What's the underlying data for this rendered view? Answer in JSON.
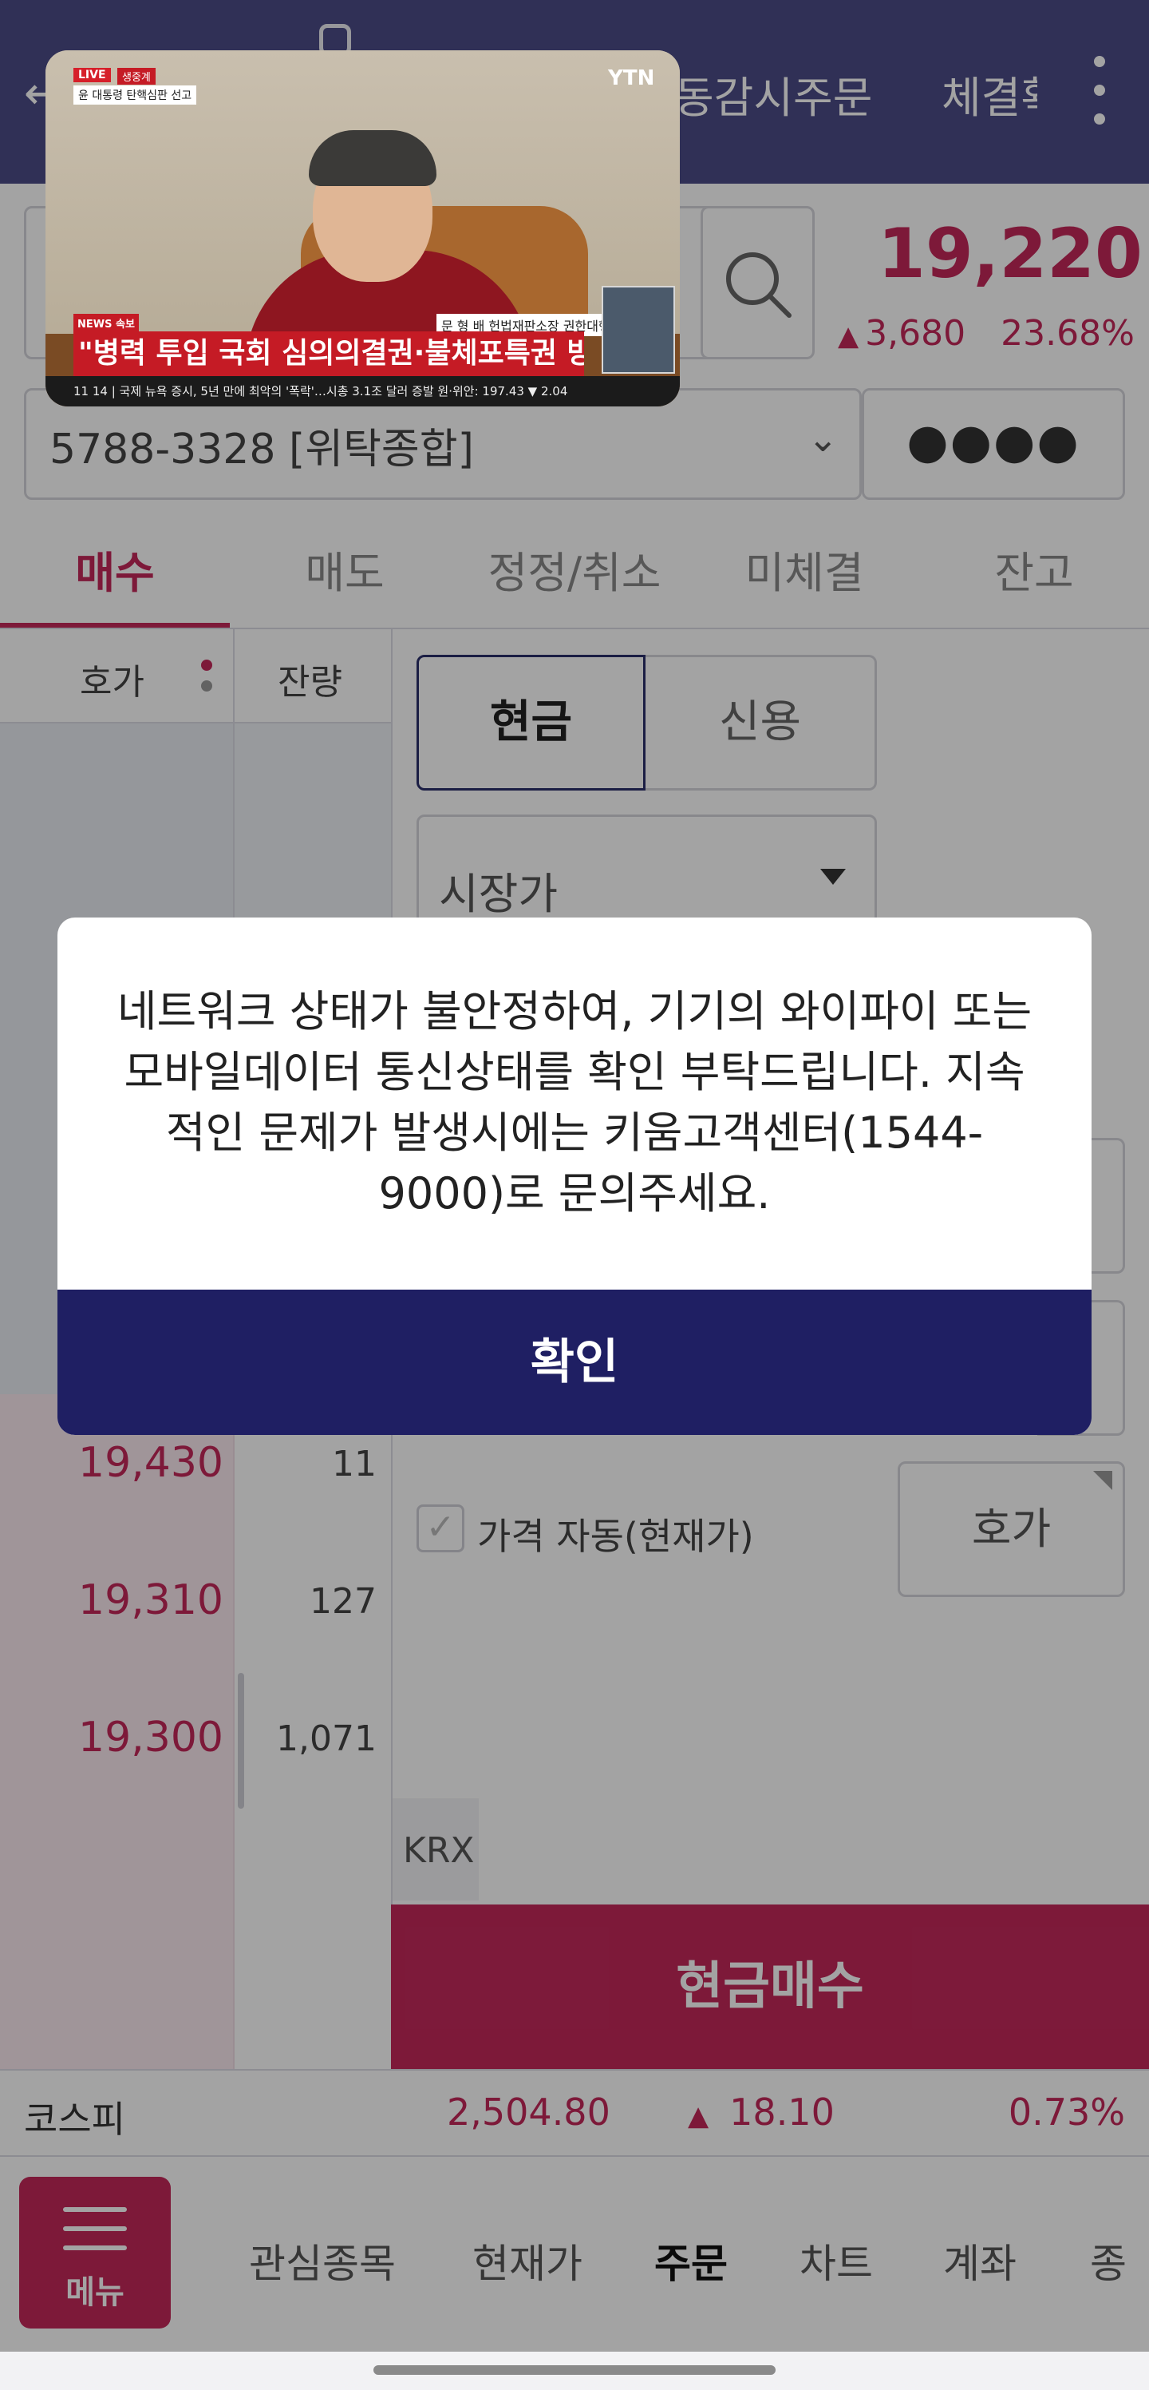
{
  "header": {
    "back_icon": "back-arrow-icon",
    "tabs": [
      "동감시주문",
      "체결확"
    ],
    "menu_icon": "kebab-menu-icon"
  },
  "stock": {
    "price": "19,220",
    "change": "3,680",
    "change_pct": "23.68%",
    "direction_icon": "up-triangle-icon"
  },
  "account": {
    "number": "5788-3328 [위탁종합]",
    "password_mask": "●●●●"
  },
  "order_tabs": [
    "매수",
    "매도",
    "정정/취소",
    "미체결",
    "잔고"
  ],
  "orderbook": {
    "header_price": "호가",
    "header_remaining": "잔량",
    "rows": [
      {
        "price": "19,430",
        "qty": "11"
      },
      {
        "price": "19,310",
        "qty": "127"
      },
      {
        "price": "19,300",
        "qty": "1,071"
      }
    ]
  },
  "order_panel": {
    "cash_label": "현금",
    "credit_label": "신용",
    "order_type": "시장가",
    "auto_price_label": "가격 자동(현재가)",
    "hoga_button": "호가",
    "exchange": "KRX",
    "submit_label": "현금매수"
  },
  "index_bar": {
    "name": "코스피",
    "value": "2,504.80",
    "change": "18.10",
    "change_pct": "0.73%"
  },
  "bottom_nav": {
    "menu_label": "메뉴",
    "items": [
      "관심종목",
      "현재가",
      "주문",
      "차트",
      "계좌",
      "종"
    ]
  },
  "video": {
    "live_badge": "LIVE",
    "live_sub": "생중계",
    "program": "윤 대통령 탄핵심판 선고",
    "channel_logo": "YTN",
    "news_tag": "NEWS 속보",
    "name_tag": "문 형 배 헌법재판소장 권한대행",
    "headline": "\"병력 투입 국회 심의의결권·불체포특권 방해\"",
    "ticker": "11 14 | 국제  뉴욕 증시, 5년 만에 최악의 '폭락'…시총 3.1조 달러 증발   원·위안: 197.43 ▼ 2.04"
  },
  "dialog": {
    "message": "네트워크 상태가 불안정하여, 기기의 와이파이 또는 모바일데이터 통신상태를 확인 부탁드립니다. 지속적인 문제가 발생시에는 키움고객센터(1544-9000)로 문의주세요.",
    "confirm_label": "확인"
  },
  "colors": {
    "header": "#4b4b87",
    "accent": "#c4285a",
    "dialog_button": "#1f1f63"
  }
}
